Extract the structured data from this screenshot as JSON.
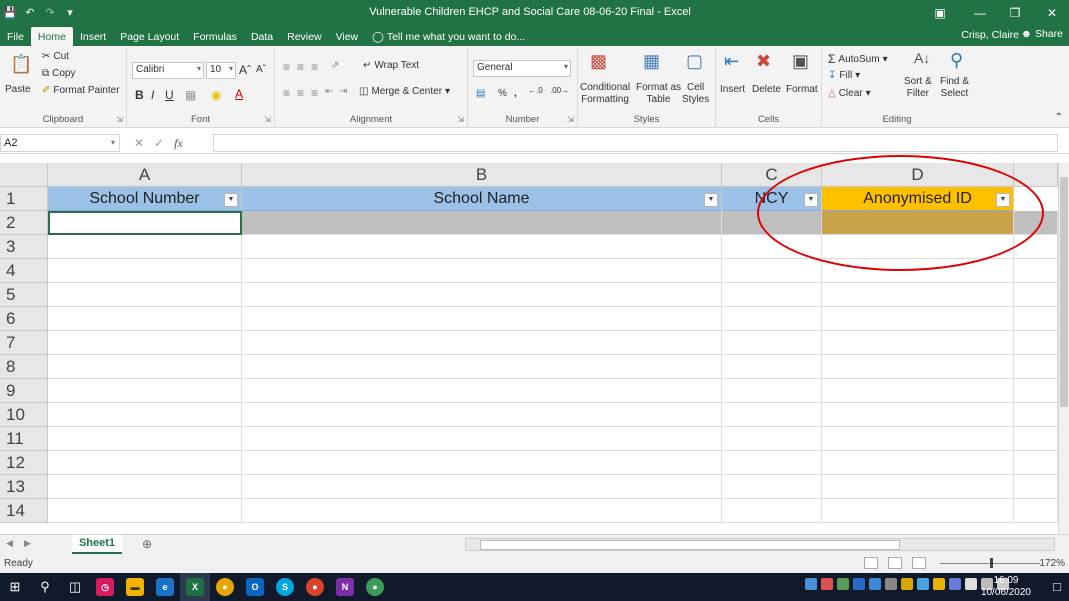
{
  "window": {
    "title": "Vulnerable Children EHCP and Social Care 08-06-20 Final - Excel",
    "user": "Crisp, Claire",
    "share": "Share"
  },
  "tabs": [
    "File",
    "Home",
    "Insert",
    "Page Layout",
    "Formulas",
    "Data",
    "Review",
    "View"
  ],
  "tell_me": "Tell me what you want to do...",
  "ribbon": {
    "clipboard": {
      "label": "Clipboard",
      "paste": "Paste",
      "cut": "Cut",
      "copy": "Copy",
      "format_painter": "Format Painter"
    },
    "font": {
      "label": "Font",
      "name": "Calibri",
      "size": "10"
    },
    "alignment": {
      "label": "Alignment",
      "wrap": "Wrap Text",
      "merge": "Merge & Center"
    },
    "number": {
      "label": "Number",
      "format": "General"
    },
    "styles": {
      "label": "Styles",
      "conditional": "Conditional",
      "formatting": "Formatting",
      "format_as": "Format as",
      "table": "Table",
      "cell": "Cell",
      "styles": "Styles"
    },
    "cells": {
      "label": "Cells",
      "insert": "Insert",
      "delete": "Delete",
      "format": "Format"
    },
    "editing": {
      "label": "Editing",
      "autosum": "AutoSum",
      "fill": "Fill",
      "clear": "Clear",
      "sort": "Sort &",
      "filter": "Filter",
      "find": "Find &",
      "select": "Select"
    }
  },
  "formula_bar": {
    "name_box": "A2",
    "fx": "fx",
    "content": ""
  },
  "columns": [
    "A",
    "B",
    "C",
    "D"
  ],
  "header_row": [
    "School Number",
    "School Name",
    "NCY",
    "Anonymised ID"
  ],
  "row_numbers": [
    "1",
    "2",
    "3",
    "4",
    "5",
    "6",
    "7",
    "8",
    "9",
    "10",
    "11",
    "12",
    "13",
    "14"
  ],
  "sheet_tab": "Sheet1",
  "status": {
    "ready": "Ready",
    "zoom": "172%"
  },
  "clock": {
    "time": "16:09",
    "date": "10/06/2020"
  },
  "colors": {
    "accent": "#217346",
    "header_fill": "#9bc2e6",
    "highlight_fill": "#c9a24a",
    "annotation": "#e00000"
  }
}
